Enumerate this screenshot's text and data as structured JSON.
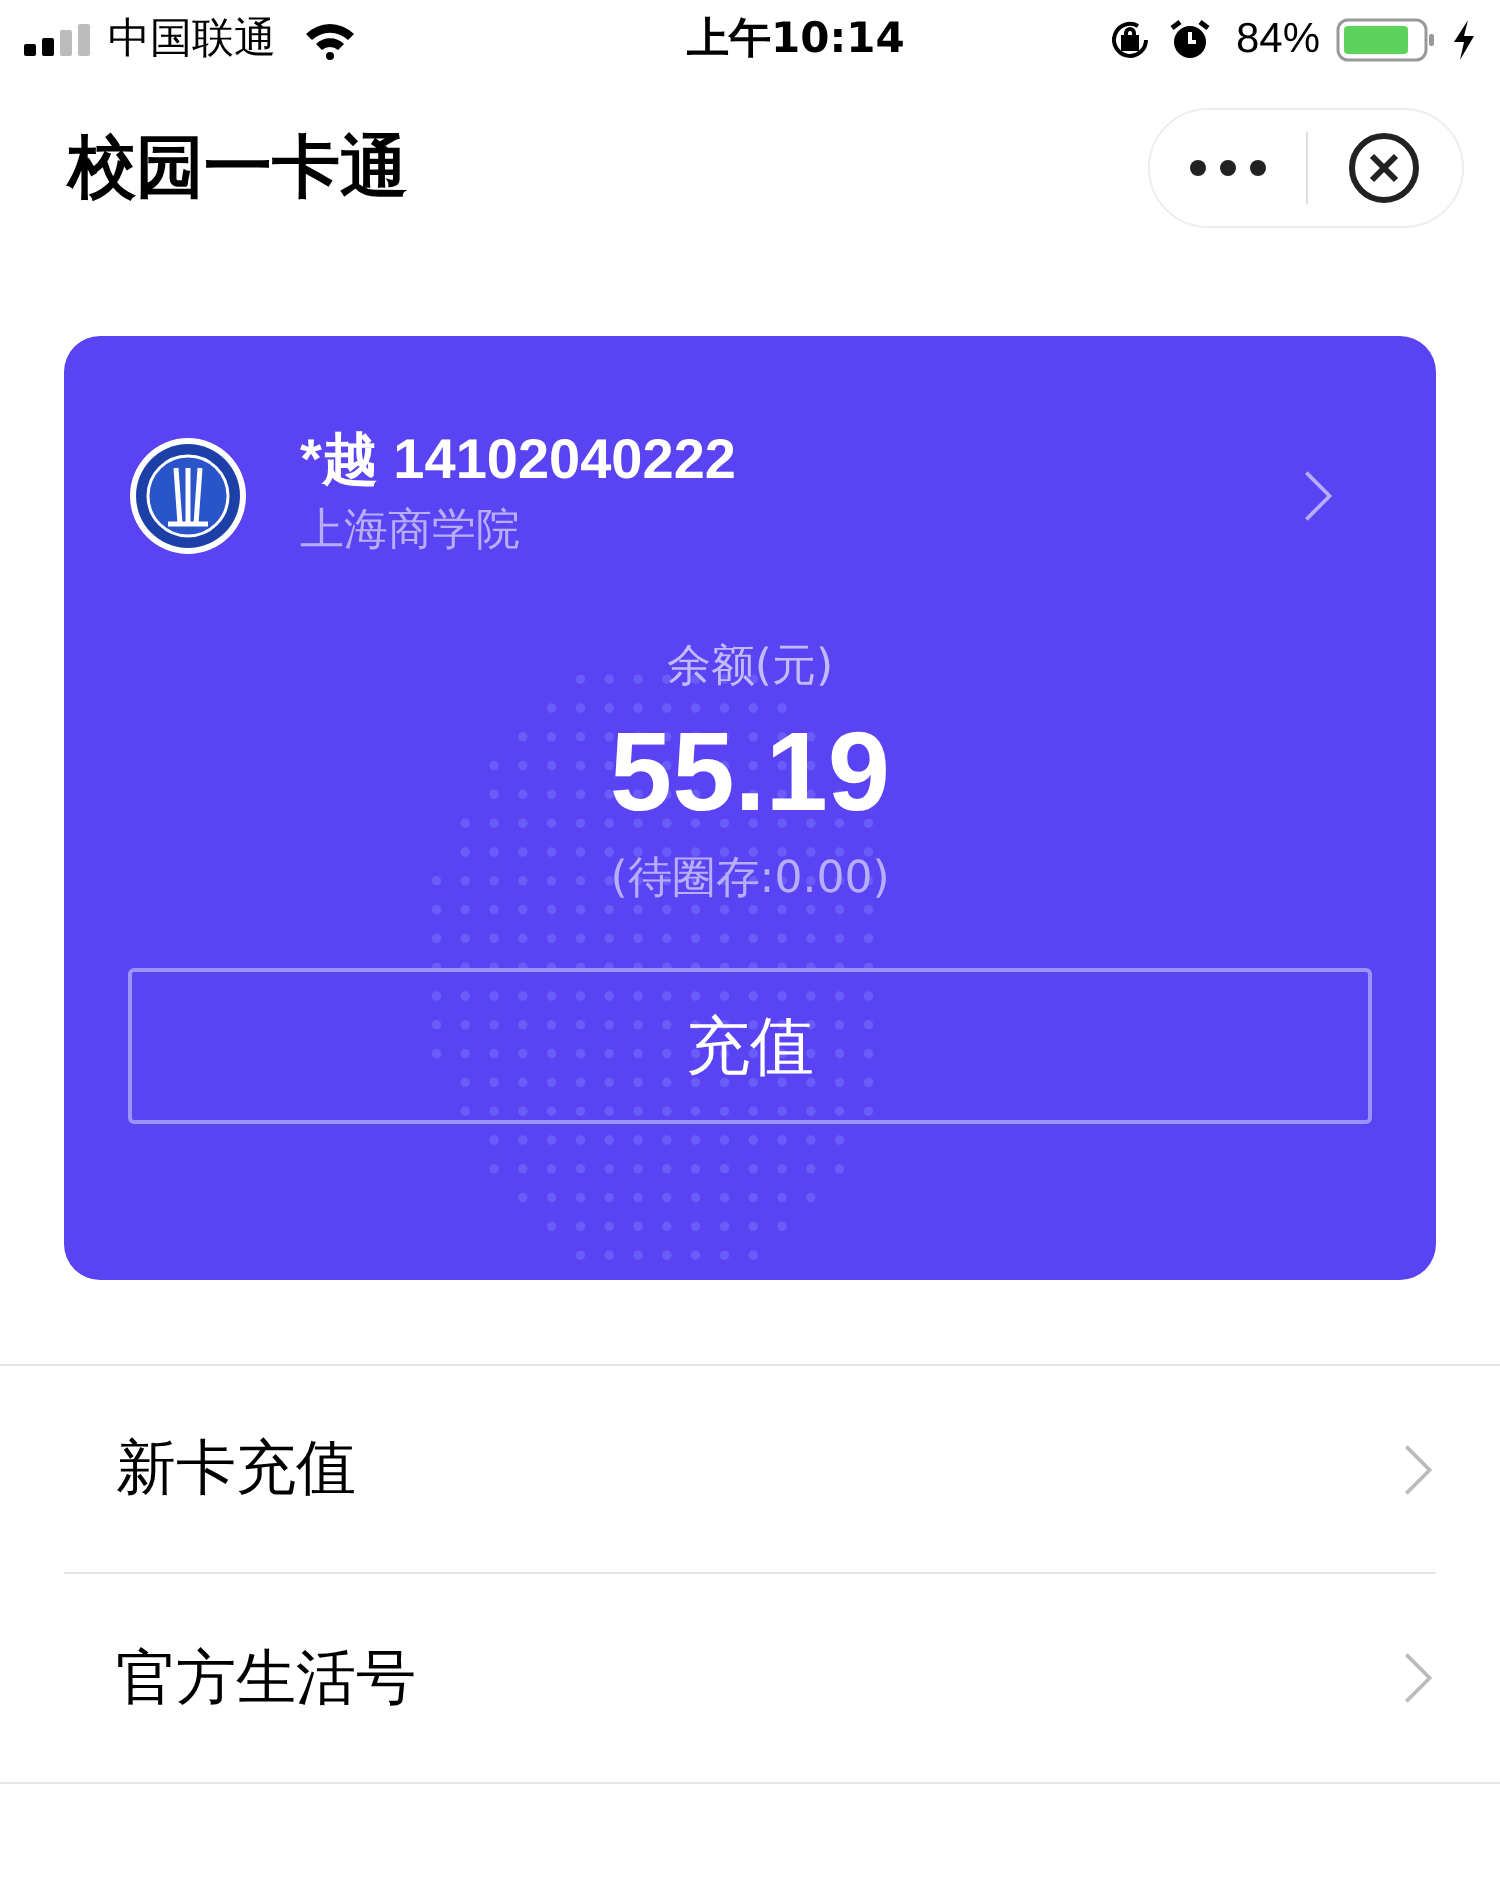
{
  "status_bar": {
    "carrier": "中国联通",
    "time": "上午10:14",
    "battery": "84%"
  },
  "header": {
    "title": "校园一卡通"
  },
  "card": {
    "name": "*越 14102040222",
    "school": "上海商学院",
    "balance_label": "余额(元)",
    "balance": "55.19",
    "pending": "(待圈存:0.00)",
    "button": "充值"
  },
  "menu": [
    {
      "label": "新卡充值"
    },
    {
      "label": "官方生活号"
    }
  ]
}
